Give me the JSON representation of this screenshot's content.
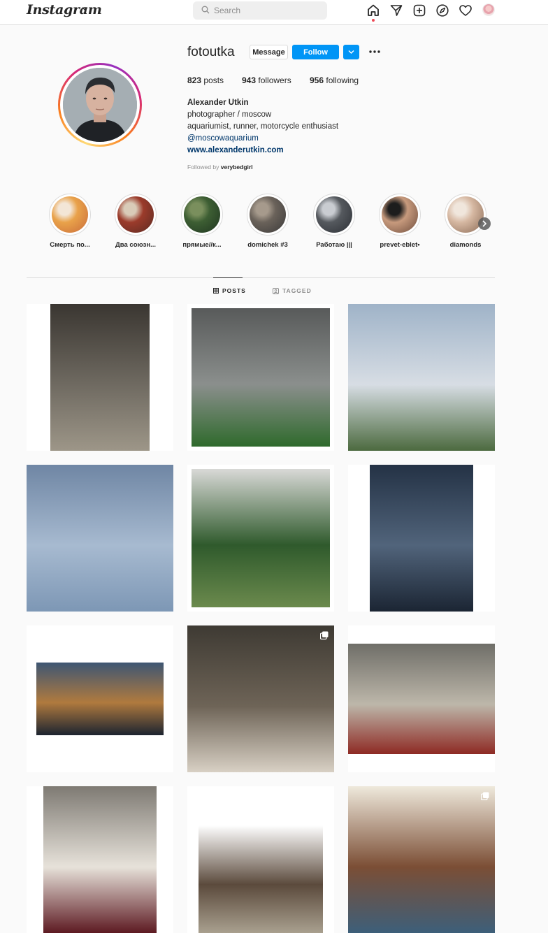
{
  "nav": {
    "logo": "Instagram",
    "search_placeholder": "Search"
  },
  "profile": {
    "username": "fotoutka",
    "message_label": "Message",
    "follow_label": "Follow",
    "stats": {
      "posts_count": "823",
      "posts_label": "posts",
      "followers_count": "943",
      "followers_label": "followers",
      "following_count": "956",
      "following_label": "following"
    },
    "bio": {
      "full_name": "Alexander Utkin",
      "line1": "photographer / moscow",
      "line2": "aquariumist, runner, motorcycle enthusiast",
      "mention": "@moscowaquarium",
      "website": "www.alexanderutkin.com"
    },
    "followed_by_prefix": "Followed by",
    "followed_by_user": "verybedgirl"
  },
  "highlights": [
    {
      "label": "Смерть по...",
      "colors": [
        "#c96b3a",
        "#e9a24a",
        "#f3e6d7"
      ]
    },
    {
      "label": "Два союзн...",
      "colors": [
        "#5a2a22",
        "#9b3b2b",
        "#d9cbb8"
      ]
    },
    {
      "label": "прямые//к...",
      "colors": [
        "#1f3520",
        "#3d5e33",
        "#7a8f5d"
      ]
    },
    {
      "label": "domichek #3",
      "colors": [
        "#3b3a3a",
        "#6a625a",
        "#a69a8c"
      ]
    },
    {
      "label": "Работаю |||",
      "colors": [
        "#2c2f35",
        "#55595e",
        "#c9ccd1"
      ]
    },
    {
      "label": "prevet-eblet•",
      "colors": [
        "#6e4c3c",
        "#c79a7d",
        "#1d1d1d"
      ]
    },
    {
      "label": "diamonds",
      "colors": [
        "#8a6a55",
        "#d6b8a2",
        "#f0e6dc"
      ]
    }
  ],
  "tabs": {
    "posts_label": "POSTS",
    "tagged_label": "TAGGED"
  },
  "icons": {
    "search": "search-icon",
    "home": "home-icon",
    "direct": "paper-plane-icon",
    "new_post": "plus-square-icon",
    "explore": "compass-icon",
    "activity": "heart-icon",
    "more": "ellipsis-icon",
    "posts_tab": "grid-icon",
    "tagged_tab": "tag-icon"
  },
  "colors": {
    "accent": "#0095f6",
    "notification_dot": "#ed4956",
    "link": "#00376b"
  },
  "posts": [
    {
      "subject": "curtain",
      "colors": [
        "#3a3631",
        "#6f6a61",
        "#9d9688"
      ],
      "multi": false
    },
    {
      "subject": "man with monstera plant",
      "colors": [
        "#585a5a",
        "#8b8f8d",
        "#2f6a2c"
      ],
      "multi": false
    },
    {
      "subject": "motorcycle by foggy lake",
      "colors": [
        "#9fb3c8",
        "#d7dde4",
        "#4c6a3f"
      ],
      "multi": false
    },
    {
      "subject": "calm sea horizon",
      "colors": [
        "#6f86a4",
        "#a7bad0",
        "#7d97b5"
      ],
      "multi": false
    },
    {
      "subject": "aquarium",
      "colors": [
        "#d9d9d7",
        "#2f5a2c",
        "#6b8a4d"
      ],
      "multi": false
    },
    {
      "subject": "view above clouds",
      "colors": [
        "#243245",
        "#51647b",
        "#1b2533"
      ],
      "multi": false
    },
    {
      "subject": "river at dusk",
      "colors": [
        "#3e5673",
        "#b07a3e",
        "#1c2430"
      ],
      "multi": false
    },
    {
      "subject": "older woman portrait",
      "colors": [
        "#3e3a33",
        "#6e6457",
        "#d8d0c4"
      ],
      "multi": true
    },
    {
      "subject": "room with bicycle",
      "colors": [
        "#6f6e68",
        "#bdb7aa",
        "#8e2a24"
      ],
      "multi": false
    },
    {
      "subject": "plate",
      "colors": [
        "#7e7a73",
        "#e7e2da",
        "#5d1a22"
      ],
      "multi": false
    },
    {
      "subject": "forest path",
      "colors": [
        "#ffffff",
        "#5b4a3c",
        "#a9a08f"
      ],
      "multi": false
    },
    {
      "subject": "bookshelf",
      "colors": [
        "#efe9dc",
        "#7b4e35",
        "#3d5f7a"
      ],
      "multi": true
    }
  ]
}
